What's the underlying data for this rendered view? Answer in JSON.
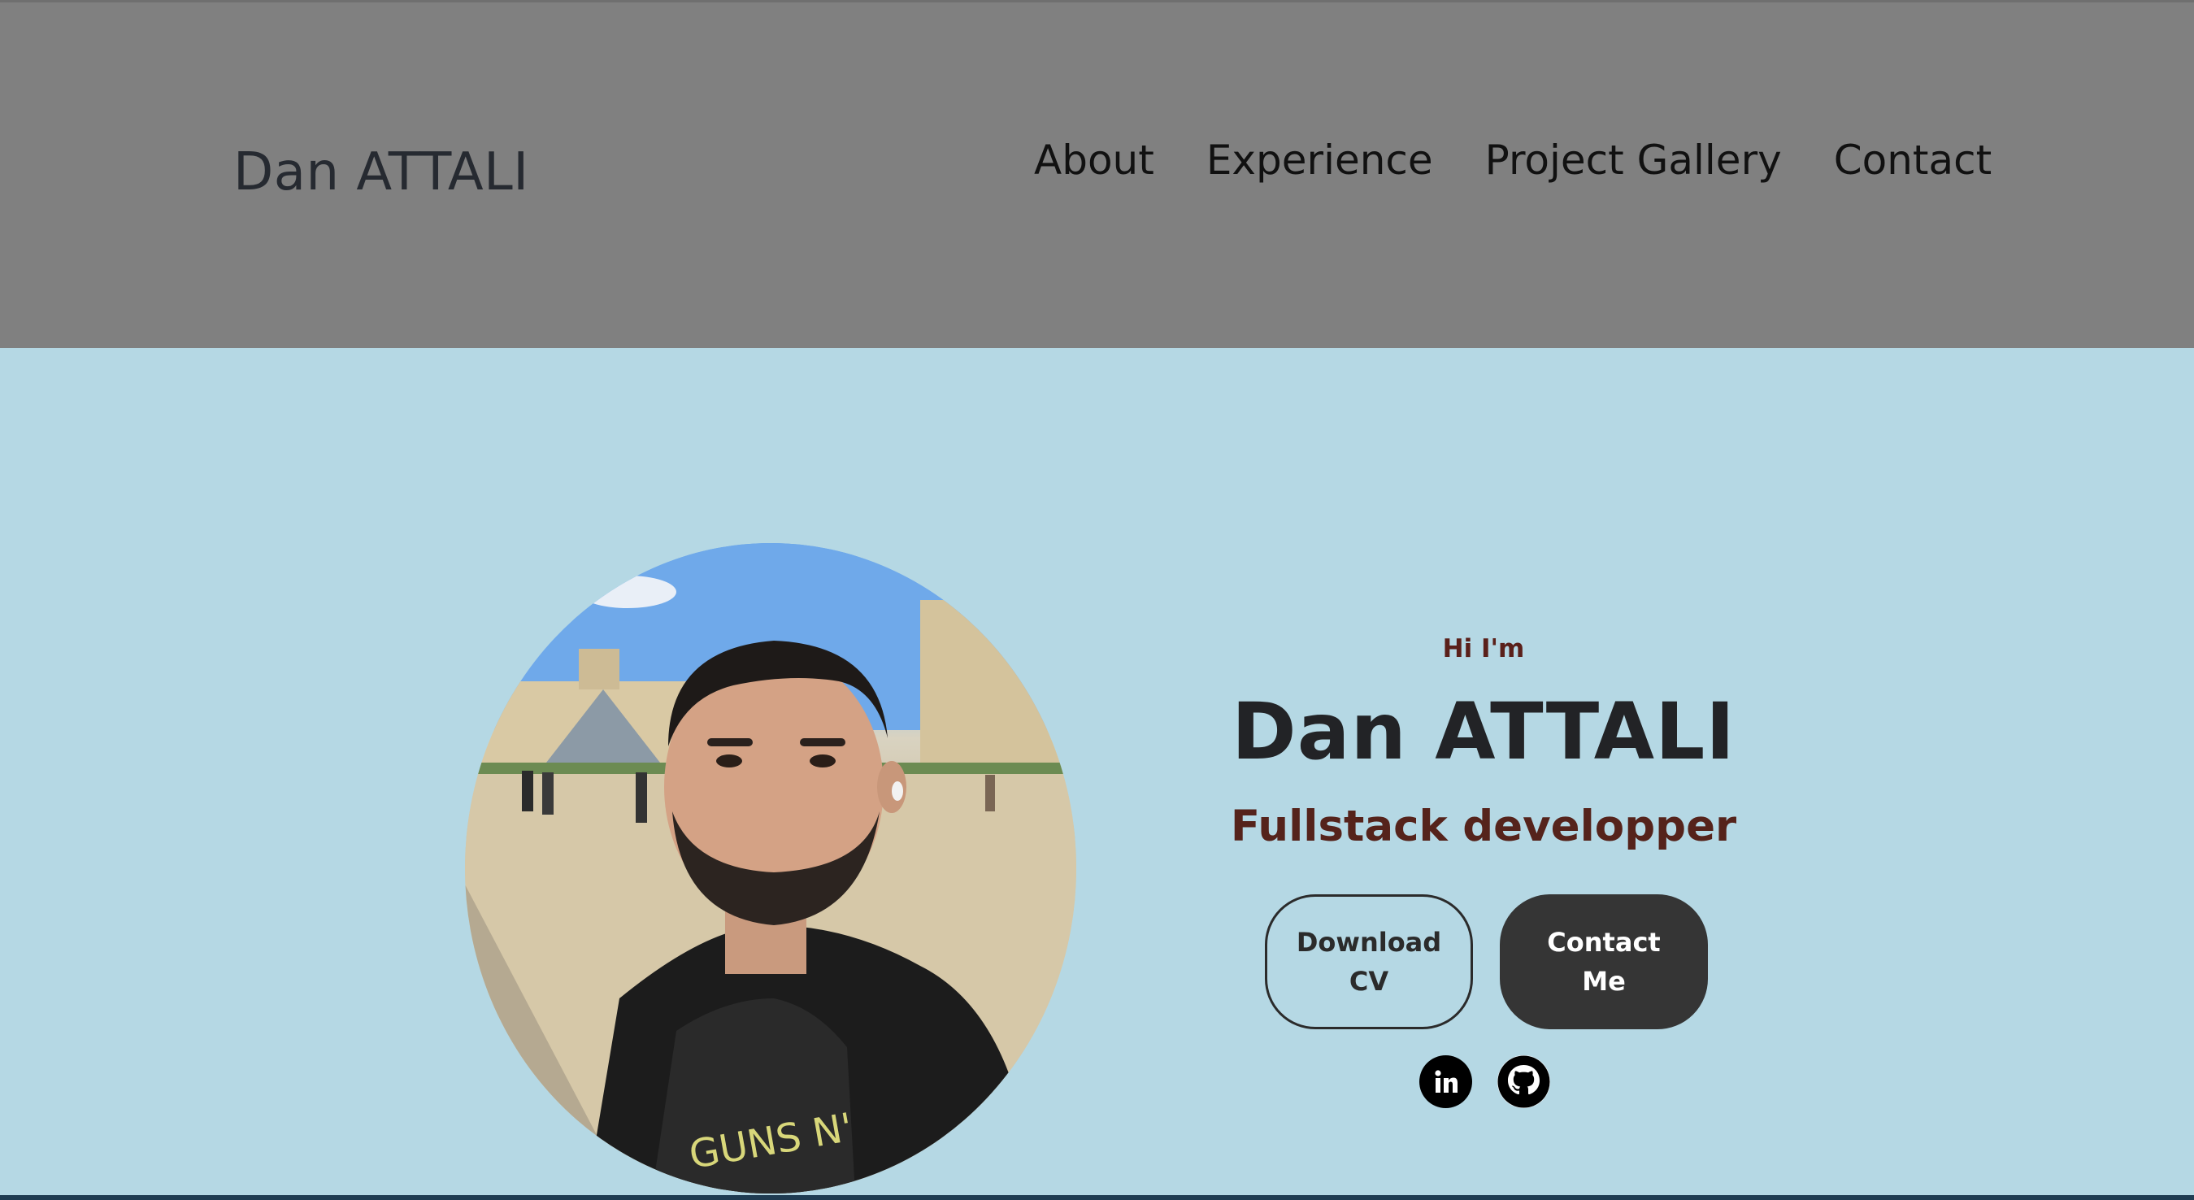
{
  "header": {
    "logo": "Dan ATTALI",
    "nav": [
      {
        "label": "About"
      },
      {
        "label": "Experience"
      },
      {
        "label": "Project Gallery"
      },
      {
        "label": "Contact"
      }
    ]
  },
  "hero": {
    "greeting": "Hi I'm",
    "name": "Dan ATTALI",
    "title": "Fullstack developper",
    "buttons": {
      "download_line1": "Download",
      "download_line2": "CV",
      "contact_line1": "Contact",
      "contact_line2": "Me"
    },
    "socials": [
      {
        "icon": "linkedin-icon"
      },
      {
        "icon": "github-icon"
      }
    ]
  },
  "colors": {
    "header_bg": "#808080",
    "hero_bg": "#b5d8e4",
    "accent_text": "#55231b",
    "button_dark": "#353535"
  }
}
